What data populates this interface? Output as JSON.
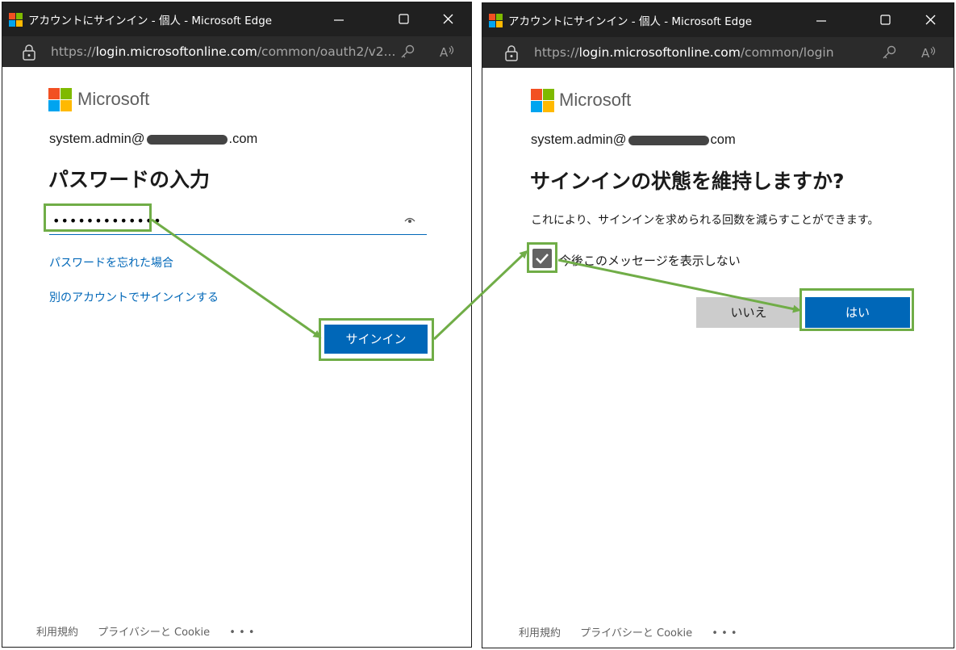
{
  "colors": {
    "accent": "#0067b8",
    "highlight": "#70ad47",
    "titlebar": "#202020",
    "addressbar": "#2b2b2b",
    "ms_red": "#f25022",
    "ms_green": "#7fba00",
    "ms_blue": "#00a4ef",
    "ms_yellow": "#ffb900"
  },
  "window1": {
    "title": "アカウントにサインイン - 個人 - Microsoft Edge",
    "url_prefix": "https://",
    "url_host": "login.microsoftonline.com",
    "url_path": "/common/oauth2/v2...",
    "brand": "Microsoft",
    "email_user": "system.admin@",
    "email_tail": ".com",
    "heading": "パスワードの入力",
    "password_mask": "•••••••••••••",
    "forgot_link": "パスワードを忘れた場合",
    "other_account_link": "別のアカウントでサインインする",
    "signin_button": "サインイン",
    "footer": {
      "terms": "利用規約",
      "privacy": "プライバシーと Cookie",
      "more": "• • •"
    }
  },
  "window2": {
    "title": "アカウントにサインイン - 個人 - Microsoft Edge",
    "url_prefix": "https://",
    "url_host": "login.microsoftonline.com",
    "url_path": "/common/login",
    "brand": "Microsoft",
    "email_user": "system.admin@",
    "email_tail": "com",
    "heading": "サインインの状態を維持しますか?",
    "description": "これにより、サインインを求められる回数を減らすことができます。",
    "checkbox_label": "今後このメッセージを表示しない",
    "checkbox_checked": true,
    "no_button": "いいえ",
    "yes_button": "はい",
    "footer": {
      "terms": "利用規約",
      "privacy": "プライバシーと Cookie",
      "more": "• • •"
    }
  },
  "icons": [
    "edge-window-icon",
    "minimize-icon",
    "maximize-icon",
    "close-icon",
    "lock-icon",
    "key-icon",
    "read-aloud-icon",
    "microsoft-logo-icon",
    "password-reveal-icon",
    "checkmark-icon",
    "arrow-icon"
  ]
}
